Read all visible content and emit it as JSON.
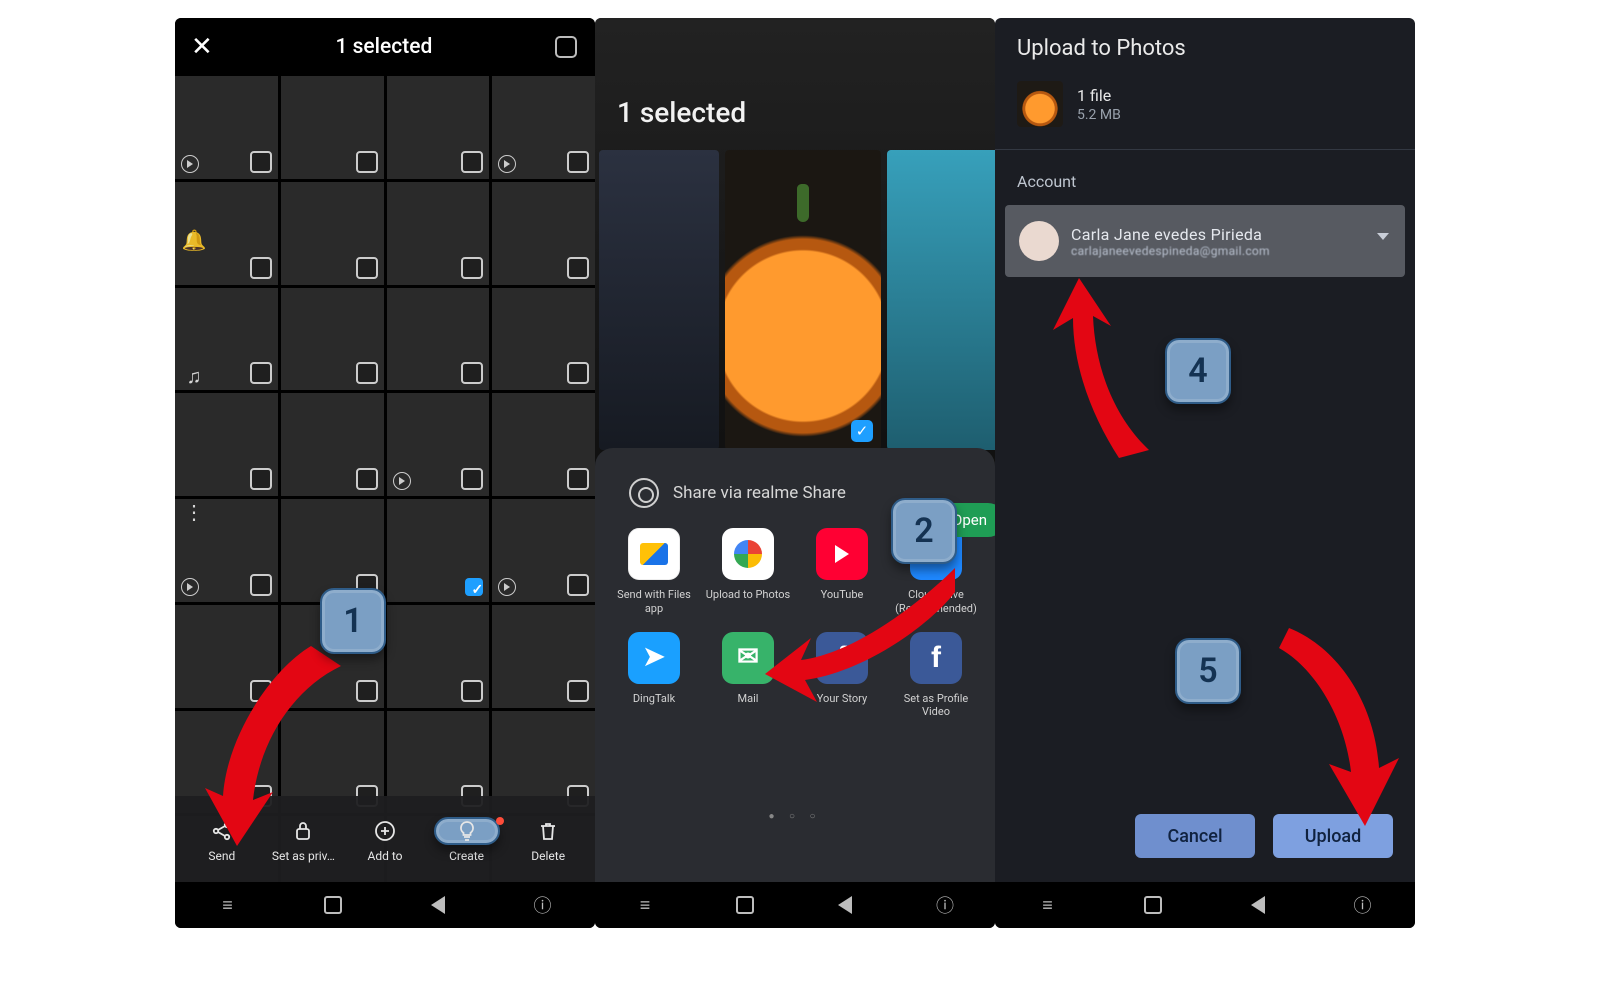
{
  "screen1": {
    "title": "1 selected",
    "bottom_bar": [
      {
        "label": "Send"
      },
      {
        "label": "Set as priv…"
      },
      {
        "label": "Add to"
      },
      {
        "label": "Create"
      },
      {
        "label": "Delete"
      }
    ]
  },
  "screen2": {
    "title": "1 selected",
    "share_via_label": "Share via realme Share",
    "open_label": "Open",
    "apps_row1": [
      {
        "label": "Send with Files app"
      },
      {
        "label": "Upload to Photos"
      },
      {
        "label": "YouTube"
      },
      {
        "label": "Cloud Drive (Recommended)"
      }
    ],
    "apps_row2": [
      {
        "label": "DingTalk"
      },
      {
        "label": "Mail"
      },
      {
        "label": "Your Story"
      },
      {
        "label": "Set as Profile Video"
      }
    ]
  },
  "screen3": {
    "header": "Upload to Photos",
    "file_count": "1 file",
    "file_size": "5.2 MB",
    "account_section": "Account",
    "account_name": "Carla Jane evedes Pirieda",
    "account_email": "carlajaneevedespineda@gmail.com",
    "cancel": "Cancel",
    "upload": "Upload"
  },
  "steps": {
    "s1": "1",
    "s2": "2",
    "s4": "4",
    "s5": "5"
  }
}
